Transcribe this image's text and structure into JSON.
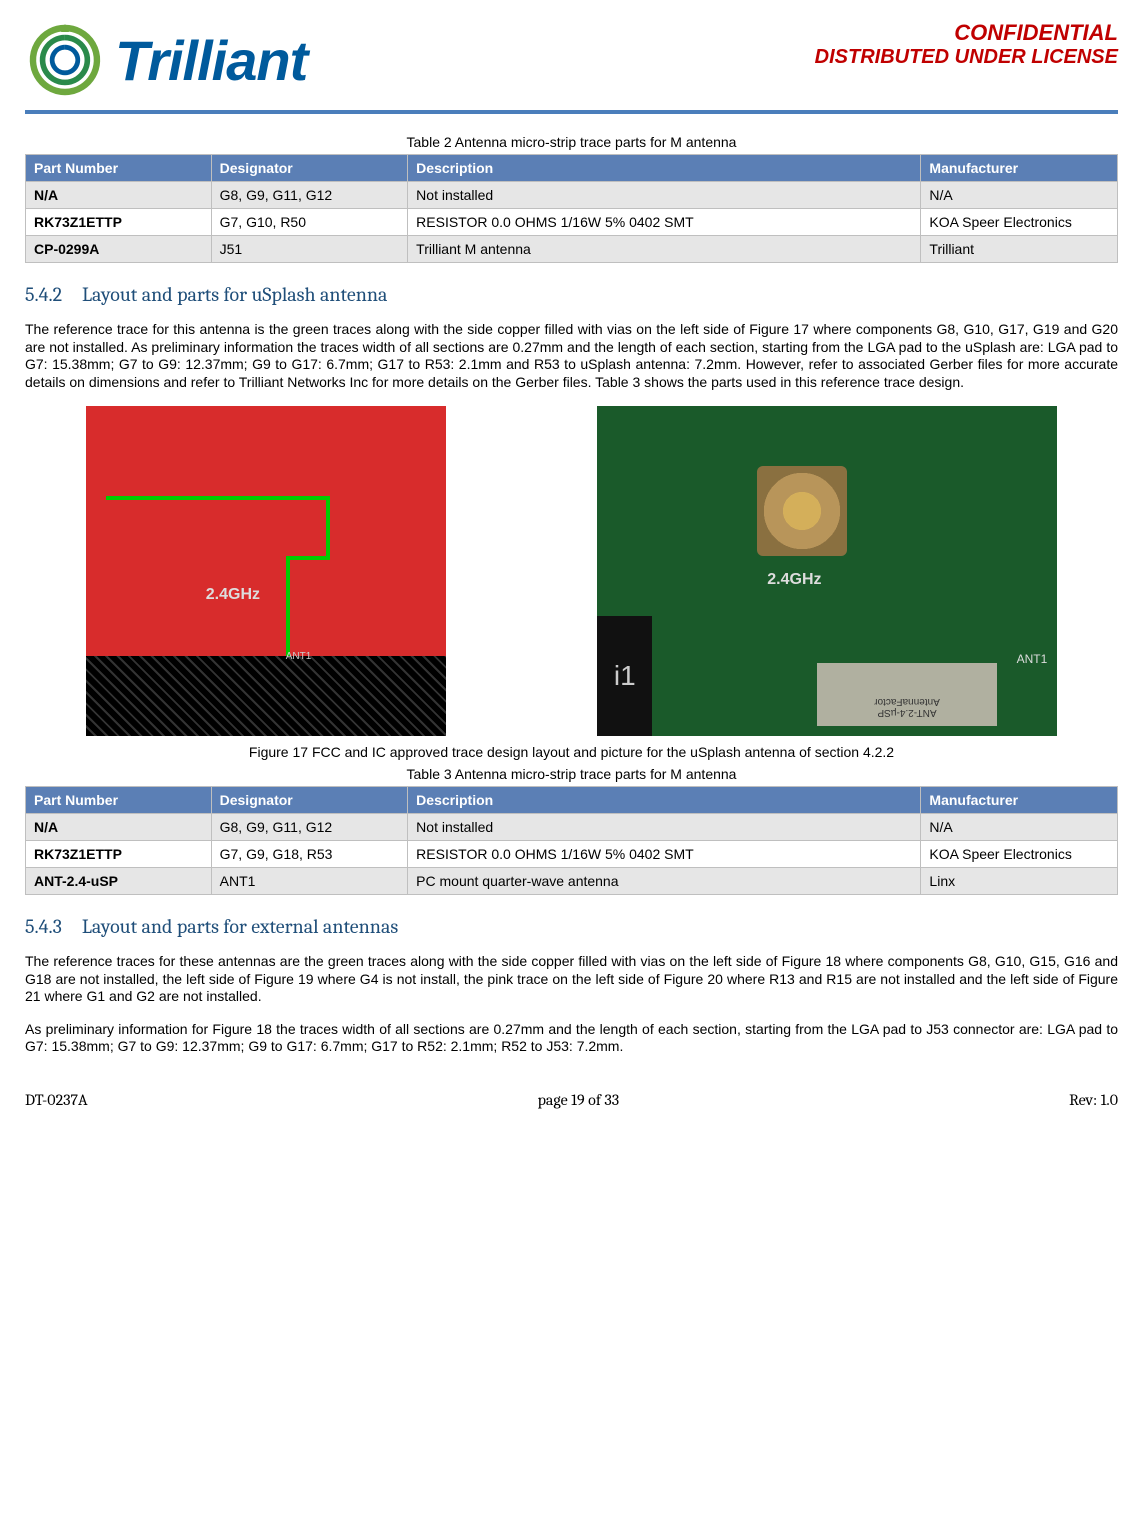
{
  "header": {
    "logo_text": "Trilliant",
    "confidential": "CONFIDENTIAL",
    "distributed": "DISTRIBUTED UNDER LICENSE"
  },
  "table2": {
    "caption": "Table 2  Antenna micro-strip trace parts for M antenna",
    "headers": [
      "Part Number",
      "Designator",
      "Description",
      "Manufacturer"
    ],
    "rows": [
      [
        "N/A",
        "G8, G9, G11, G12",
        "Not installed",
        "N/A"
      ],
      [
        "RK73Z1ETTP",
        "G7, G10, R50",
        "RESISTOR 0.0 OHMS 1/16W 5% 0402 SMT",
        "KOA Speer Electronics"
      ],
      [
        "CP-0299A",
        "J51",
        "Trilliant M antenna",
        "Trilliant"
      ]
    ]
  },
  "section_542": {
    "num": "5.4.2",
    "title": "Layout and parts for uSplash antenna",
    "body": "The reference trace for this antenna is the green traces along with the side copper filled with vias on the left side of Figure 17 where components G8, G10, G17, G19 and G20 are not installed.  As preliminary information the traces width of all sections are 0.27mm and the length of each section, starting from the LGA pad to the uSplash are: LGA pad to G7: 15.38mm; G7 to G9: 12.37mm; G9 to G17: 6.7mm; G17 to R53: 2.1mm and R53 to uSplash antenna: 7.2mm.  However, refer to associated Gerber files for more accurate details on dimensions and refer to Trilliant Networks Inc for more details on the Gerber files.  Table 3 shows the parts used in this reference trace design."
  },
  "figure17": {
    "caption": "Figure 17  FCC and IC approved trace design layout and picture for the uSplash antenna of section 4.2.2",
    "ghz": "2.4GHz",
    "ant1": "ANT1"
  },
  "table3": {
    "caption": "Table 3  Antenna micro-strip trace parts for M antenna",
    "headers": [
      "Part Number",
      "Designator",
      "Description",
      "Manufacturer"
    ],
    "rows": [
      [
        "N/A",
        "G8, G9, G11, G12",
        "Not installed",
        "N/A"
      ],
      [
        "RK73Z1ETTP",
        "G7, G9, G18, R53",
        "RESISTOR 0.0 OHMS 1/16W 5% 0402 SMT",
        "KOA Speer Electronics"
      ],
      [
        "ANT-2.4-uSP",
        "ANT1",
        "PC mount quarter-wave antenna",
        "Linx"
      ]
    ]
  },
  "section_543": {
    "num": "5.4.3",
    "title": "Layout and parts for external antennas",
    "body1": "The reference traces for these antennas are the green traces along with the side copper filled with vias on the left side of Figure 18 where components G8, G10, G15, G16 and G18 are not installed, the left side of Figure 19 where G4 is not install, the pink trace on the left side of Figure 20 where R13 and R15 are not installed and the left side of Figure 21 where G1 and G2 are not installed.",
    "body2": "As preliminary information for Figure 18 the traces width of all sections are 0.27mm and the length of each section, starting from the LGA pad to J53 connector are: LGA pad to G7: 15.38mm; G7 to G9: 12.37mm; G9 to G17: 6.7mm; G17 to R52: 2.1mm; R52 to J53: 7.2mm."
  },
  "footer": {
    "doc_id": "DT-0237A",
    "page": "page 19 of 33",
    "rev": "Rev: 1.0"
  }
}
